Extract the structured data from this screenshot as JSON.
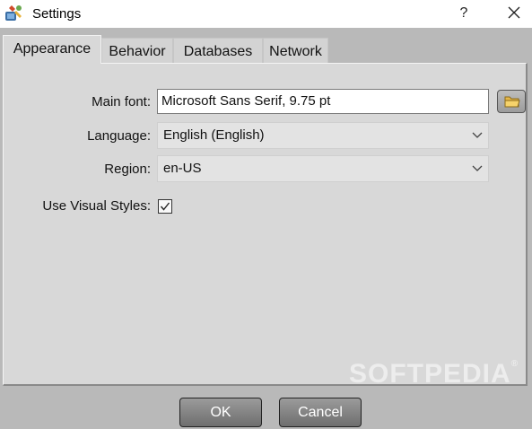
{
  "window": {
    "title": "Settings",
    "help_label": "?"
  },
  "tabs": [
    {
      "label": "Appearance",
      "active": true
    },
    {
      "label": "Behavior",
      "active": false
    },
    {
      "label": "Databases",
      "active": false
    },
    {
      "label": "Network",
      "active": false
    }
  ],
  "appearance": {
    "main_font_label": "Main font:",
    "main_font_value": "Microsoft Sans Serif, 9.75 pt",
    "language_label": "Language:",
    "language_value": "English (English)",
    "region_label": "Region:",
    "region_value": "en-US",
    "visual_styles_label": "Use Visual Styles:",
    "visual_styles_checked": true
  },
  "watermark": {
    "text": "SOFTPEDIA",
    "mark": "®"
  },
  "buttons": {
    "ok_label": "OK",
    "cancel_label": "Cancel"
  },
  "colors": {
    "panel_bg": "#d8d8d8",
    "dialog_bg": "#b9b9b9",
    "button_bg": "#7f7f7f"
  },
  "icons": {
    "app": "app-tools-icon",
    "browse": "folder-icon",
    "dropdown": "chevron-down-icon",
    "close": "close-icon"
  }
}
